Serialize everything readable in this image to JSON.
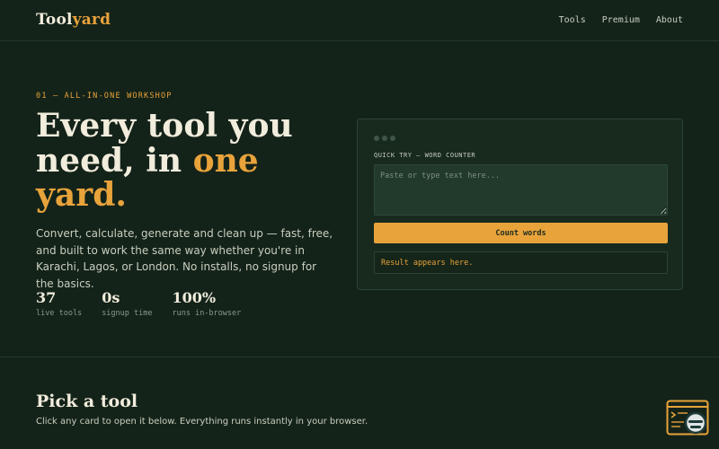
{
  "header": {
    "logo_main": "Tool",
    "logo_accent": "yard",
    "nav": [
      "Tools",
      "Premium",
      "About"
    ]
  },
  "hero": {
    "eyebrow": "01 — ALL-IN-ONE WORKSHOP",
    "headline_1": "Every tool you need, in ",
    "headline_accent": "one yard.",
    "lede": "Convert, calculate, generate and clean up — fast, free, and built to work the same way whether you're in Karachi, Lagos, or London. No installs, no signup for the basics.",
    "stats": [
      {
        "value": "37",
        "label": "live tools"
      },
      {
        "value": "0s",
        "label": "signup time"
      },
      {
        "value": "100%",
        "label": "runs in-browser"
      }
    ]
  },
  "quick_try": {
    "label": "QUICK TRY — WORD COUNTER",
    "placeholder": "Paste or type text here...",
    "button": "Count words",
    "result": "Result appears here."
  },
  "section": {
    "title": "Pick a tool",
    "subtitle": "Click any card to open it below. Everything runs instantly in your browser."
  },
  "icons": {
    "floating_widget": "terminal-search-icon"
  },
  "colors": {
    "background": "#142319",
    "accent": "#e8a33b",
    "text": "#f1ecdc"
  }
}
